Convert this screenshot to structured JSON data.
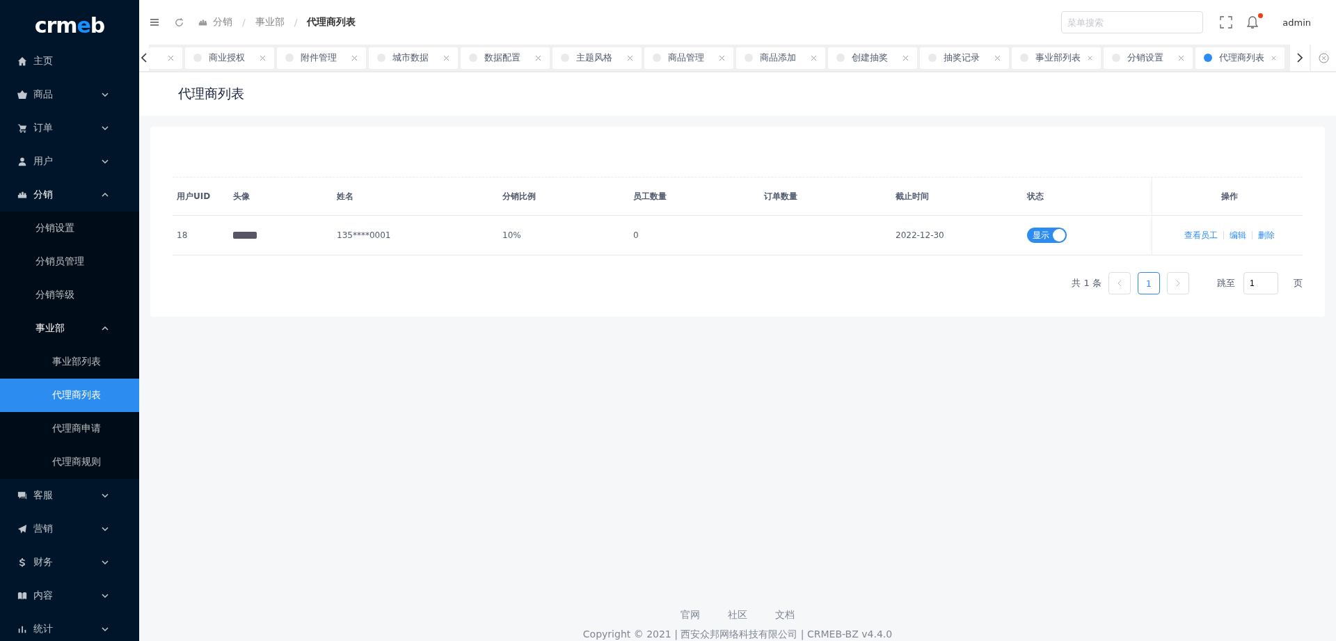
{
  "sidebar": {
    "logo": [
      {
        "text": "crm",
        "accent": false
      },
      {
        "text": "e",
        "accent": true
      },
      {
        "text": "b",
        "accent": false
      }
    ],
    "menu": [
      {
        "kind": "link",
        "label": "主页",
        "selected": false
      },
      {
        "kind": "group",
        "label": "商品",
        "expanded": false
      },
      {
        "kind": "group",
        "label": "订单",
        "expanded": false
      },
      {
        "kind": "group",
        "label": "用户",
        "expanded": false
      },
      {
        "kind": "group",
        "label": "分销",
        "expanded": true,
        "children": [
          {
            "kind": "link",
            "label": "分销设置",
            "selected": false
          },
          {
            "kind": "link",
            "label": "分销员管理",
            "selected": false
          },
          {
            "kind": "link",
            "label": "分销等级",
            "selected": false
          },
          {
            "kind": "group",
            "label": "事业部",
            "expanded": true,
            "children": [
              {
                "kind": "link",
                "label": "事业部列表",
                "selected": false
              },
              {
                "kind": "link",
                "label": "代理商列表",
                "selected": true
              },
              {
                "kind": "link",
                "label": "代理商申请",
                "selected": false
              },
              {
                "kind": "link",
                "label": "代理商规则",
                "selected": false
              }
            ]
          }
        ]
      },
      {
        "kind": "group",
        "label": "客服",
        "expanded": false
      },
      {
        "kind": "group",
        "label": "营销",
        "expanded": false
      },
      {
        "kind": "group",
        "label": "财务",
        "expanded": false
      },
      {
        "kind": "group",
        "label": "内容",
        "expanded": false
      },
      {
        "kind": "group",
        "label": "统计",
        "expanded": false
      }
    ]
  },
  "header": {
    "breadcrumb": [
      {
        "label": "分销",
        "current": false
      },
      {
        "label": "事业部",
        "current": false
      },
      {
        "label": "代理商列表",
        "current": true
      }
    ],
    "breadcrumb_separator": "/",
    "search": {
      "placeholder": "菜单搜索"
    },
    "notification_dot": true,
    "user": "admin"
  },
  "tabs": [
    {
      "kind": "clipped",
      "selected": false
    },
    {
      "kind": "tab",
      "label": "商业授权",
      "selected": false
    },
    {
      "kind": "tab",
      "label": "附件管理",
      "selected": false
    },
    {
      "kind": "tab",
      "label": "城市数据",
      "selected": false
    },
    {
      "kind": "tab",
      "label": "数据配置",
      "selected": false
    },
    {
      "kind": "tab",
      "label": "主题风格",
      "selected": false
    },
    {
      "kind": "tab",
      "label": "商品管理",
      "selected": false
    },
    {
      "kind": "tab",
      "label": "商品添加",
      "selected": false
    },
    {
      "kind": "tab",
      "label": "创建抽奖",
      "selected": false
    },
    {
      "kind": "tab",
      "label": "抽奖记录",
      "selected": false
    },
    {
      "kind": "tab",
      "label": "事业部列表",
      "selected": false
    },
    {
      "kind": "tab",
      "label": "分销设置",
      "selected": false
    },
    {
      "kind": "tab",
      "label": "代理商列表",
      "selected": true
    }
  ],
  "page_title": "代理商列表",
  "table": {
    "columns": [
      "用户UID",
      "头像",
      "姓名",
      "分销比例",
      "员工数量",
      "订单数量",
      "截止时间",
      "状态",
      "操作"
    ],
    "rows": [
      {
        "uid": "18",
        "name": "135****0001",
        "ratio": "10%",
        "staff": "0",
        "deadline": "2022-12-30",
        "status": {
          "on": true,
          "label": "显示"
        },
        "actions": [
          "查看员工",
          "编辑",
          "删除"
        ]
      }
    ]
  },
  "pagination": {
    "total": "共 1 条",
    "pages": [
      {
        "label": "1",
        "selected": true
      }
    ],
    "jump_label": "跳至",
    "jump_value": "1",
    "page_unit": "页"
  },
  "footer": {
    "links": [
      "官网",
      "社区",
      "文档"
    ],
    "copyright": "Copyright © 2021 | 西安众邦网络科技有限公司 | CRMEB-BZ v4.4.0"
  }
}
